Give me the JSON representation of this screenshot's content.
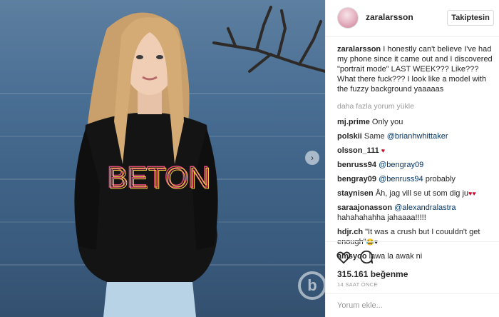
{
  "post": {
    "username": "zaralarsson",
    "follow_label": "Takiptesin",
    "caption_text": "I honestly can't believe I've had my phone since it came out and I discovered \"portrait mode\" LAST WEEK??? Like??? What there fuck??? I look like a model with the fuzzy background yaaaaas",
    "load_more_label": "daha fazla yorum yükle",
    "likes": "315.161 beğenme",
    "time_ago": "14 SAAT ÖNCE",
    "comment_placeholder": "Yorum ekle..."
  },
  "photo": {
    "sweater_text": "BETON",
    "watermark": "b"
  },
  "comments": [
    {
      "user": "mj.prime",
      "mention": "",
      "text": "Only you",
      "emoji": ""
    },
    {
      "user": "polskii",
      "mention": "@brianhwhittaker",
      "text": "Same",
      "emoji": ""
    },
    {
      "user": "olsson_111",
      "mention": "",
      "text": "",
      "emoji": "♥"
    },
    {
      "user": "benruss94",
      "mention": "@bengray09",
      "text": "",
      "emoji": ""
    },
    {
      "user": "bengray09",
      "mention": "@benruss94",
      "text": "probably",
      "emoji": ""
    },
    {
      "user": "staynisen",
      "mention": "",
      "text": "Åh, jag vill se ut som dig ju",
      "emoji": "♥♥"
    },
    {
      "user": "saraajonasson",
      "mention": "@alexandralastra",
      "text": "hahahahahha jahaaaa!!!!!",
      "emoji": ""
    },
    {
      "user": "hdjr.ch",
      "mention": "",
      "text": "\"It was a crush but I couuldn't get enough\"",
      "emoji": "😂♥"
    },
    {
      "user": "amsyoo",
      "mention": "",
      "text": "lawa la awak ni",
      "emoji": ""
    }
  ],
  "icons": {
    "like": "heart-outline-icon",
    "comment": "speech-bubble-icon",
    "next": "chevron-right-icon"
  }
}
